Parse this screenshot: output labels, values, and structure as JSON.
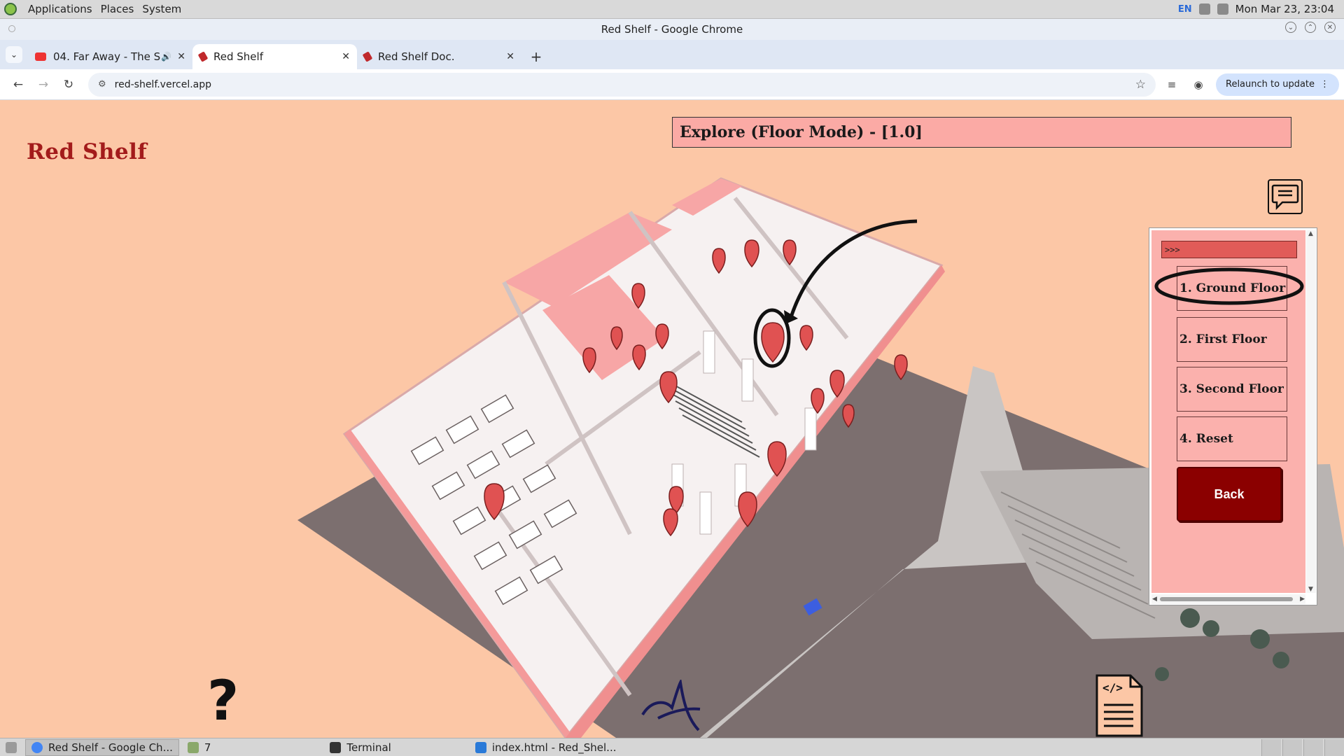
{
  "topbar": {
    "menus": [
      "Applications",
      "Places",
      "System"
    ],
    "lang": "EN",
    "clock": "Mon Mar 23, 23:04"
  },
  "window": {
    "title": "Red Shelf - Google Chrome"
  },
  "tabs": [
    {
      "label": "04. Far Away - The Se",
      "active": false,
      "audio": true
    },
    {
      "label": "Red Shelf",
      "active": true,
      "audio": false
    },
    {
      "label": "Red Shelf Doc.",
      "active": false,
      "audio": false
    }
  ],
  "toolbar": {
    "url": "red-shelf.vercel.app",
    "relaunch_label": "Relaunch to update"
  },
  "page": {
    "brand": "Red Shelf",
    "mode_title": "Explore (Floor Mode) - [1.0]",
    "filter_value": ">>>",
    "floors": [
      "1. Ground Floor",
      "2. First Floor",
      "3. Second Floor",
      "4. Reset"
    ],
    "back_label": "Back",
    "help_glyph": "?",
    "doc_code_glyph": "</>"
  },
  "colors": {
    "page_bg": "#fcc7a6",
    "brand_red": "#a31b1b",
    "panel_pink": "#fbb1ad",
    "back_btn": "#8b0000",
    "marker_red": "#e05252",
    "building_wall": "#f4f0f0",
    "building_accent": "#f49a9a",
    "ground": "#7c6f6f"
  },
  "taskbar": {
    "items": [
      "Red Shelf - Google Ch...",
      "7",
      "Terminal",
      "index.html - Red_Shel..."
    ]
  }
}
